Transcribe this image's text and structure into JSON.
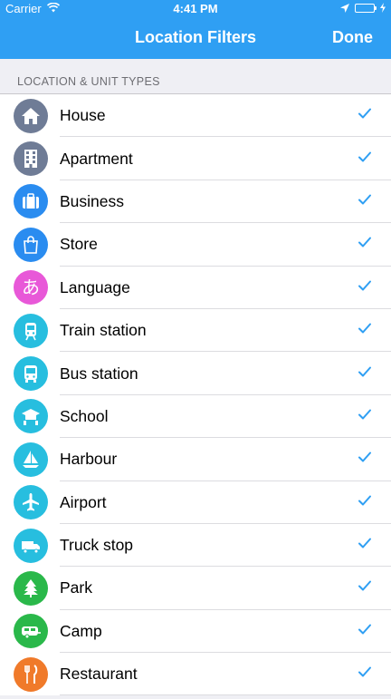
{
  "status": {
    "carrier": "Carrier",
    "time": "4:41 PM"
  },
  "nav": {
    "title": "Location Filters",
    "done": "Done"
  },
  "section": {
    "header": "LOCATION & UNIT TYPES"
  },
  "colors": {
    "accent": "#2f9ff3",
    "check": "#2f9ff3"
  },
  "items": [
    {
      "label": "House",
      "color": "#6f7c96",
      "icon": "house-icon",
      "checked": true
    },
    {
      "label": "Apartment",
      "color": "#6f7c96",
      "icon": "apartment-icon",
      "checked": true
    },
    {
      "label": "Business",
      "color": "#2a8cf0",
      "icon": "briefcase-icon",
      "checked": true
    },
    {
      "label": "Store",
      "color": "#2a8cf0",
      "icon": "shopping-bag-icon",
      "checked": true
    },
    {
      "label": "Language",
      "color": "#e858d8",
      "icon": "hiragana-a-icon",
      "checked": true
    },
    {
      "label": "Train station",
      "color": "#27bedf",
      "icon": "train-icon",
      "checked": true
    },
    {
      "label": "Bus station",
      "color": "#27bedf",
      "icon": "bus-icon",
      "checked": true
    },
    {
      "label": "School",
      "color": "#27bedf",
      "icon": "school-icon",
      "checked": true
    },
    {
      "label": "Harbour",
      "color": "#27bedf",
      "icon": "sailboat-icon",
      "checked": true
    },
    {
      "label": "Airport",
      "color": "#27bedf",
      "icon": "airplane-icon",
      "checked": true
    },
    {
      "label": "Truck stop",
      "color": "#27bedf",
      "icon": "truck-icon",
      "checked": true
    },
    {
      "label": "Park",
      "color": "#2ab84a",
      "icon": "tree-icon",
      "checked": true
    },
    {
      "label": "Camp",
      "color": "#2ab84a",
      "icon": "camper-icon",
      "checked": true
    },
    {
      "label": "Restaurant",
      "color": "#f07a2a",
      "icon": "fork-knife-icon",
      "checked": true
    }
  ]
}
